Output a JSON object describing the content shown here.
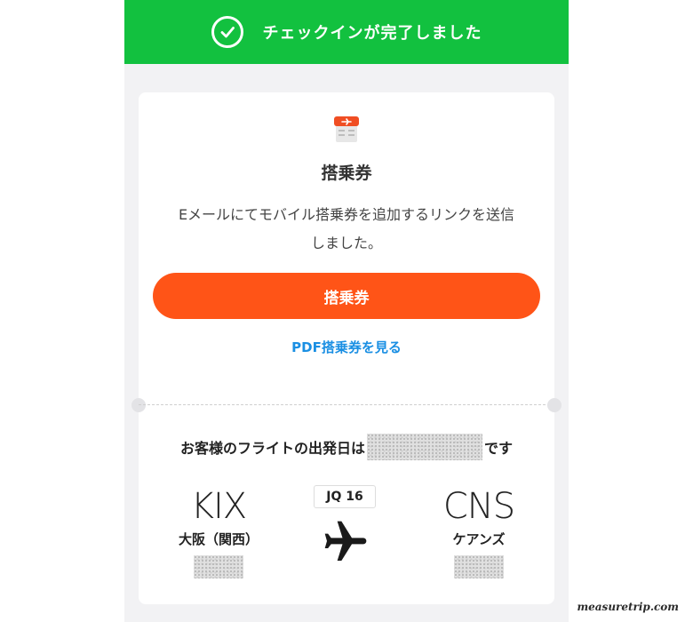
{
  "banner": {
    "icon": "check-circle-icon",
    "title": "チェックインが完了しました",
    "color": "#12c13f"
  },
  "boarding_card": {
    "icon": "boarding-pass-icon",
    "title": "搭乗券",
    "description": "Eメールにてモバイル搭乗券を追加するリンクを送信しました。",
    "primary_button_label": "搭乗券",
    "primary_button_color": "#ff5417",
    "pdf_link_label": "PDF搭乗券を見る",
    "link_color": "#1a8fe3"
  },
  "flight": {
    "date_prefix": "お客様のフライトの出発日は",
    "date_suffix": "です",
    "flight_number": "JQ 16",
    "origin": {
      "code": "KIX",
      "city": "大阪（関西）"
    },
    "destination": {
      "code": "CNS",
      "city": "ケアンズ"
    },
    "plane_icon": "airplane-icon"
  },
  "watermark": "measuretrip.com"
}
